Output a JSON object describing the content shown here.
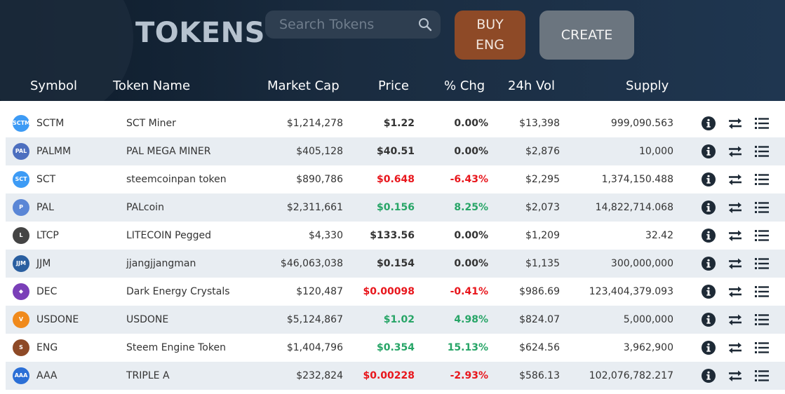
{
  "header": {
    "title": "TOKENS",
    "search_placeholder": "Search Tokens",
    "buy_line1": "BUY",
    "buy_line2": "ENG",
    "create_label": "CREATE"
  },
  "columns": {
    "symbol": "Symbol",
    "name": "Token Name",
    "market_cap": "Market Cap",
    "price": "Price",
    "change": "% Chg",
    "volume": "24h Vol",
    "supply": "Supply"
  },
  "colors": {
    "positive": "#27a567",
    "negative": "#e8161c",
    "neutral": "#333333",
    "buy_button": "#8e4a27",
    "create_button": "#6b757f"
  },
  "tokens": [
    {
      "symbol": "SCTM",
      "name": "SCT Miner",
      "market_cap": "$1,214,278",
      "price": "$1.22",
      "change": "0.00%",
      "volume": "$13,398",
      "supply": "999,090.563",
      "trend": "neutral",
      "logo_color": "#3d9bf5",
      "logo_text": "SCTM"
    },
    {
      "symbol": "PALMM",
      "name": "PAL MEGA MINER",
      "market_cap": "$405,128",
      "price": "$40.51",
      "change": "0.00%",
      "volume": "$2,876",
      "supply": "10,000",
      "trend": "neutral",
      "logo_color": "#4d6fbf",
      "logo_text": "PAL"
    },
    {
      "symbol": "SCT",
      "name": "steemcoinpan token",
      "market_cap": "$890,786",
      "price": "$0.648",
      "change": "-6.43%",
      "volume": "$2,295",
      "supply": "1,374,150.488",
      "trend": "down",
      "logo_color": "#3d9bf5",
      "logo_text": "SCT"
    },
    {
      "symbol": "PAL",
      "name": "PALcoin",
      "market_cap": "$2,311,661",
      "price": "$0.156",
      "change": "8.25%",
      "volume": "$2,073",
      "supply": "14,822,714.068",
      "trend": "up",
      "logo_color": "#5a86d6",
      "logo_text": "P"
    },
    {
      "symbol": "LTCP",
      "name": "LITECOIN Pegged",
      "market_cap": "$4,330",
      "price": "$133.56",
      "change": "0.00%",
      "volume": "$1,209",
      "supply": "32.42",
      "trend": "neutral",
      "logo_color": "#444444",
      "logo_text": "L"
    },
    {
      "symbol": "JJM",
      "name": "jjangjjangman",
      "market_cap": "$46,063,038",
      "price": "$0.154",
      "change": "0.00%",
      "volume": "$1,135",
      "supply": "300,000,000",
      "trend": "neutral",
      "logo_color": "#2a5fa0",
      "logo_text": "JJM"
    },
    {
      "symbol": "DEC",
      "name": "Dark Energy Crystals",
      "market_cap": "$120,487",
      "price": "$0.00098",
      "change": "-0.41%",
      "volume": "$986.69",
      "supply": "123,404,379.093",
      "trend": "down",
      "logo_color": "#7a3fb8",
      "logo_text": "◆"
    },
    {
      "symbol": "USDONE",
      "name": "USDONE",
      "market_cap": "$5,124,867",
      "price": "$1.02",
      "change": "4.98%",
      "volume": "$824.07",
      "supply": "5,000,000",
      "trend": "up",
      "logo_color": "#f08a1c",
      "logo_text": "V"
    },
    {
      "symbol": "ENG",
      "name": "Steem Engine Token",
      "market_cap": "$1,404,796",
      "price": "$0.354",
      "change": "15.13%",
      "volume": "$624.56",
      "supply": "3,962,900",
      "trend": "up",
      "logo_color": "#8e4a27",
      "logo_text": "S"
    },
    {
      "symbol": "AAA",
      "name": "TRIPLE A",
      "market_cap": "$232,824",
      "price": "$0.00228",
      "change": "-2.93%",
      "volume": "$586.13",
      "supply": "102,076,782.217",
      "trend": "down",
      "logo_color": "#2b6fd6",
      "logo_text": "AAA"
    }
  ],
  "icons": {
    "info": "info-icon",
    "transfer": "transfer-icon",
    "list": "list-icon",
    "search": "search-icon"
  }
}
